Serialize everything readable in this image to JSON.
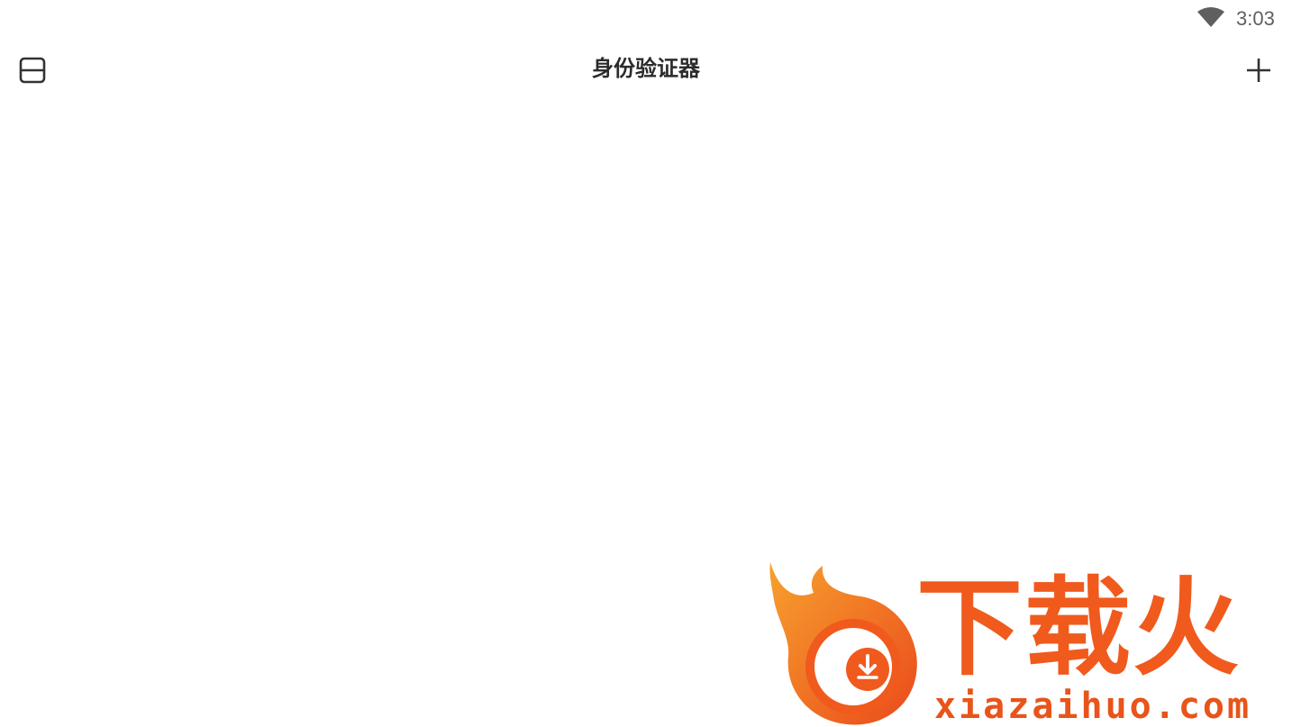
{
  "status_bar": {
    "time": "3:03",
    "wifi_icon": "wifi-icon"
  },
  "app_bar": {
    "title": "身份验证器",
    "menu_icon": "layout-menu-icon",
    "add_icon": "plus-icon"
  },
  "watermark": {
    "brand_cn": "下载火",
    "brand_url": "xiazaihuo.com",
    "logo_icon": "flame-download-logo-icon",
    "colors": {
      "primary": "#f05a1d",
      "secondary": "#f7a12e"
    }
  },
  "theme": {
    "background": "#ffffff",
    "title_color": "#2b2b2b",
    "icon_color": "#333333",
    "status_color": "#5f5f5f"
  }
}
